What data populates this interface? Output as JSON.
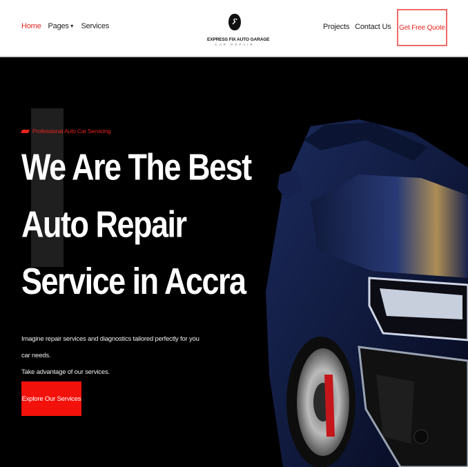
{
  "nav": {
    "left": [
      "Home",
      "Pages",
      "Services"
    ],
    "right": [
      "Projects",
      "Contact Us"
    ],
    "cta": "Get Free Quote"
  },
  "logo": {
    "name": "EXPRESS FIX AUTO GARAGE",
    "sub": "CAR REPAIR"
  },
  "hero": {
    "tag": "Professional Auto Car Servicing",
    "headline": [
      "We Are The Best",
      "Auto Repair",
      "Service in Accra"
    ],
    "desc_line1": "Imagine repair services and diagnostics tailored perfectly for you car needs.",
    "desc_line2": "Take advantage of our services.",
    "cta": "Explore Our Services"
  },
  "colors": {
    "accent": "#e8231d",
    "background": "#000000",
    "header": "#ffffff"
  },
  "icons": [
    "cart-icon",
    "caret-down-icon",
    "wrench-icon"
  ]
}
